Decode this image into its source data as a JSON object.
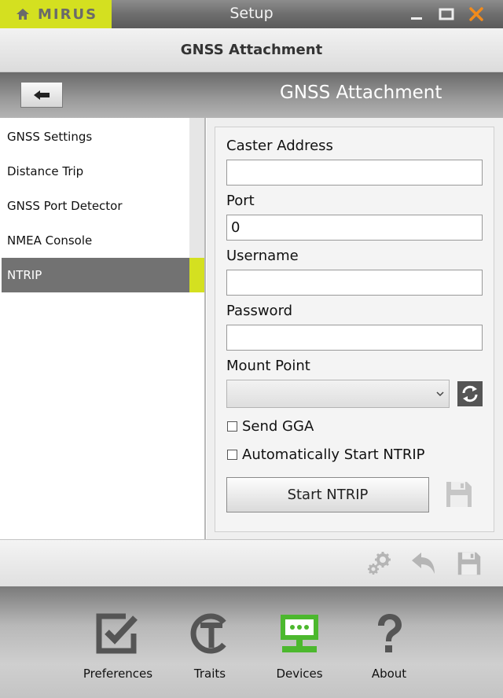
{
  "app": {
    "logo_text": "MIRUS",
    "window_title": "Setup"
  },
  "header": {
    "title": "GNSS Attachment"
  },
  "subheader": {
    "title": "GNSS Attachment"
  },
  "sidebar": {
    "items": [
      {
        "label": "GNSS Settings"
      },
      {
        "label": "Distance Trip"
      },
      {
        "label": "GNSS Port Detector"
      },
      {
        "label": "NMEA Console"
      },
      {
        "label": "NTRIP"
      }
    ],
    "active_index": 4
  },
  "form": {
    "caster_address": {
      "label": "Caster Address",
      "value": ""
    },
    "port": {
      "label": "Port",
      "value": "0"
    },
    "username": {
      "label": "Username",
      "value": ""
    },
    "password": {
      "label": "Password",
      "value": ""
    },
    "mount_point": {
      "label": "Mount Point",
      "value": ""
    },
    "send_gga": {
      "label": "Send GGA",
      "checked": false
    },
    "auto_start": {
      "label": "Automatically Start NTRIP",
      "checked": false
    },
    "start_button": "Start NTRIP"
  },
  "bottom_nav": {
    "items": [
      {
        "label": "Preferences",
        "icon": "checkbox-icon"
      },
      {
        "label": "Traits",
        "icon": "traits-icon"
      },
      {
        "label": "Devices",
        "icon": "devices-icon"
      },
      {
        "label": "About",
        "icon": "question-icon"
      }
    ],
    "active_index": 2
  },
  "colors": {
    "accent": "#d4e020",
    "active_item": "#727272",
    "devices_icon": "#4cb82e"
  }
}
